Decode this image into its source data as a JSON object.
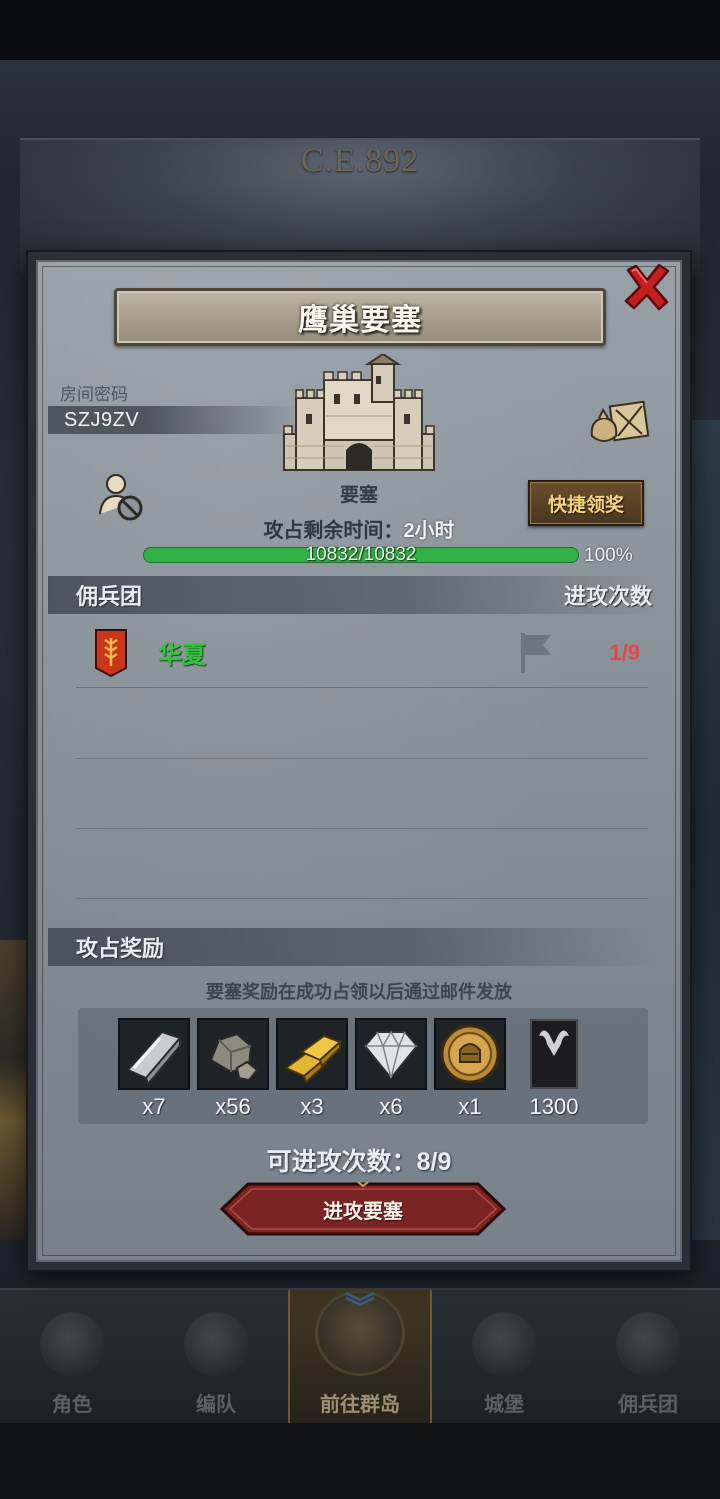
{
  "background": {
    "year_text": "C.E.892"
  },
  "dialog": {
    "title": "鹰巢要塞",
    "room": {
      "label": "房间密码",
      "code": "SZJ9ZV"
    },
    "fortress_label": "要塞",
    "quick_claim_label": "快捷领奖",
    "remaining_time": {
      "prefix": "攻占剩余时间：",
      "value": "2小时"
    },
    "progress": {
      "current": 10832,
      "max": 10832,
      "text": "10832/10832",
      "percent_text": "100%",
      "fraction": 1.0
    },
    "guild_section": {
      "title": "佣兵团",
      "attacks_header": "进攻次数",
      "rows": [
        {
          "name": "华夏",
          "attacks": "1/9"
        }
      ]
    },
    "reward_section": {
      "title": "攻占奖励",
      "note": "要塞奖励在成功占领以后通过邮件发放",
      "items": [
        {
          "icon": "iron-ingot-icon",
          "qty": "x7"
        },
        {
          "icon": "stone-ore-icon",
          "qty": "x56"
        },
        {
          "icon": "gold-bars-icon",
          "qty": "x3"
        },
        {
          "icon": "diamond-icon",
          "qty": "x6"
        },
        {
          "icon": "knight-medal-icon",
          "qty": "x1"
        },
        {
          "icon": "horned-banner-icon",
          "qty": "1300"
        }
      ]
    },
    "attack_count": {
      "prefix": "可进攻次数：",
      "value": "8/9"
    },
    "attack_button_label": "进攻要塞"
  },
  "bottom_nav": {
    "items": [
      {
        "label": "角色",
        "icon": "knight-helmet-icon"
      },
      {
        "label": "编队",
        "icon": "formation-icon"
      },
      {
        "label": "前往群岛",
        "icon": "compass-icon",
        "active": true
      },
      {
        "label": "城堡",
        "icon": "castle-icon"
      },
      {
        "label": "佣兵团",
        "icon": "guild-banner-icon"
      }
    ]
  },
  "colors": {
    "progress_green": "#31b146",
    "guild_name_green": "#33c43f",
    "attacks_red": "#e74444",
    "claim_gold": "#f5d47a",
    "attack_button_red": "#7a2424"
  }
}
